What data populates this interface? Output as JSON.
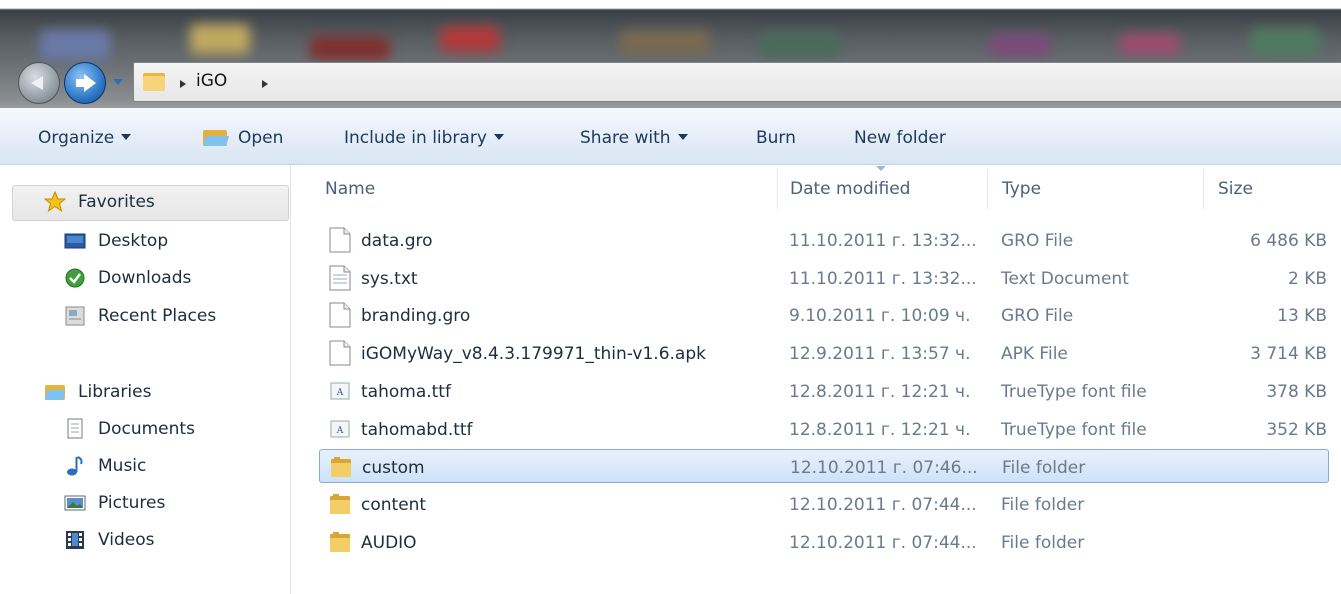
{
  "address": {
    "crumbs": [
      "iGO"
    ]
  },
  "toolbar": {
    "organize": "Organize",
    "open": "Open",
    "include": "Include in library",
    "share": "Share with",
    "burn": "Burn",
    "new_folder": "New folder"
  },
  "nav": {
    "favorites": "Favorites",
    "desktop": "Desktop",
    "downloads": "Downloads",
    "recent": "Recent Places",
    "libraries": "Libraries",
    "documents": "Documents",
    "music": "Music",
    "pictures": "Pictures",
    "videos": "Videos"
  },
  "columns": {
    "name": "Name",
    "date": "Date modified",
    "type": "Type",
    "size": "Size"
  },
  "files": [
    {
      "name": "data.gro",
      "date": "11.10.2011 г. 13:32...",
      "type": "GRO File",
      "size": "6 486 KB",
      "icon": "blank-file-icon"
    },
    {
      "name": "sys.txt",
      "date": "11.10.2011 г. 13:32...",
      "type": "Text Document",
      "size": "2 KB",
      "icon": "text-file-icon"
    },
    {
      "name": "branding.gro",
      "date": "9.10.2011 г. 10:09 ч.",
      "type": "GRO File",
      "size": "13 KB",
      "icon": "blank-file-icon"
    },
    {
      "name": "iGOMyWay_v8.4.3.179971_thin-v1.6.apk",
      "date": "12.9.2011 г. 13:57 ч.",
      "type": "APK File",
      "size": "3 714 KB",
      "icon": "blank-file-icon"
    },
    {
      "name": "tahoma.ttf",
      "date": "12.8.2011 г. 12:21 ч.",
      "type": "TrueType font file",
      "size": "378 KB",
      "icon": "font-file-icon"
    },
    {
      "name": "tahomabd.ttf",
      "date": "12.8.2011 г. 12:21 ч.",
      "type": "TrueType font file",
      "size": "352 KB",
      "icon": "font-file-icon"
    },
    {
      "name": "custom",
      "date": "12.10.2011 г. 07:46...",
      "type": "File folder",
      "size": "",
      "icon": "folder-icon",
      "selected": true
    },
    {
      "name": "content",
      "date": "12.10.2011 г. 07:44...",
      "type": "File folder",
      "size": "",
      "icon": "folder-icon"
    },
    {
      "name": "AUDIO",
      "date": "12.10.2011 г. 07:44...",
      "type": "File folder",
      "size": "",
      "icon": "folder-icon"
    }
  ],
  "colors": {
    "accent": "#1e395b",
    "selection": "#cde2f8",
    "selection_border": "#84acdd"
  }
}
